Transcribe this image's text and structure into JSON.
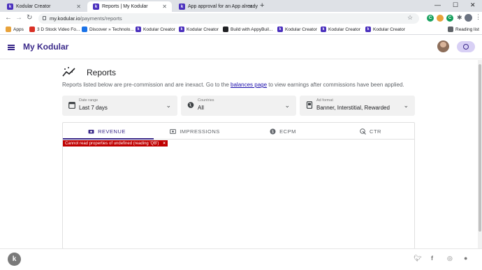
{
  "browser": {
    "tabs": [
      {
        "title": "Kodular Creator",
        "favicon": "k-logo-icon"
      },
      {
        "title": "Reports | My Kodular",
        "favicon": "k-logo-icon"
      },
      {
        "title": "App approval for an App already",
        "favicon": "k-logo-icon"
      }
    ],
    "url_host": "my.kodular.io",
    "url_path": "/payments/reports",
    "bookmarks": [
      {
        "label": "Apps"
      },
      {
        "label": "3 D Stock Video Fo..."
      },
      {
        "label": "Discover » Technolo..."
      },
      {
        "label": "Kodular Creator"
      },
      {
        "label": "Kodular Creator"
      },
      {
        "label": "Build with AppyBuil..."
      },
      {
        "label": "Kodular Creator"
      },
      {
        "label": "Kodular Creator"
      },
      {
        "label": "Kodular Creator"
      }
    ],
    "reading_list": "Reading list",
    "extensions": [
      {
        "letter": "C",
        "color": "#1aa260"
      },
      {
        "letter": "",
        "color": "#e8a23a"
      },
      {
        "letter": "C",
        "color": "#0f9d58"
      }
    ]
  },
  "app": {
    "brand": "My Kodular",
    "accent": "#3b2a8a"
  },
  "reports": {
    "title": "Reports",
    "subtitle_before": "Reports listed below are pre-commission and are inexact. Go to the ",
    "subtitle_link": "balances page",
    "subtitle_after": " to view earnings after commissions have been applied."
  },
  "filters": [
    {
      "label": "Date range",
      "value": "Last 7 days",
      "icon": "calendar-icon"
    },
    {
      "label": "Countries",
      "value": "All",
      "icon": "globe-icon"
    },
    {
      "label": "Ad format",
      "value": "Banner, Interstitial, Rewarded",
      "icon": "ad-format-icon"
    }
  ],
  "tabs": [
    {
      "label": "REVENUE",
      "icon": "revenue-icon",
      "active": true
    },
    {
      "label": "IMPRESSIONS",
      "icon": "impressions-icon",
      "active": false
    },
    {
      "label": "ECPM",
      "icon": "ecpm-icon",
      "active": false
    },
    {
      "label": "CTR",
      "icon": "ctr-icon",
      "active": false
    }
  ],
  "error": {
    "message": "Cannot read properties of undefined (reading 'QB')",
    "close": "×"
  },
  "footer": {
    "social": [
      "twitter-icon",
      "facebook-icon",
      "instagram-icon",
      "github-icon"
    ]
  }
}
